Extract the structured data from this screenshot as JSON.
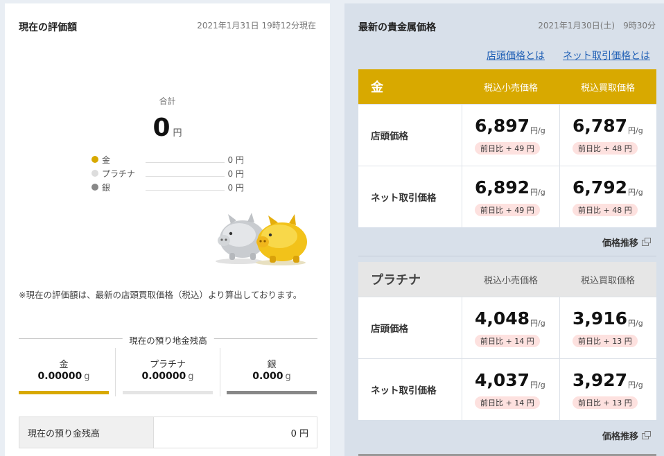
{
  "left": {
    "title": "現在の評価額",
    "timestamp": "2021年1月31日 19時12分現在",
    "total_label": "合計",
    "total_value": "0",
    "total_unit": "円",
    "breakdown": [
      {
        "name": "金",
        "value": "0 円",
        "color": "#d8a900"
      },
      {
        "name": "プラチナ",
        "value": "0 円",
        "color": "#dddddd"
      },
      {
        "name": "銀",
        "value": "0 円",
        "color": "#888888"
      }
    ],
    "note": "※現在の評価額は、最新の店頭買取価格（税込）より算出しております。",
    "holdings_title": "現在の預り地金残高",
    "holdings": [
      {
        "name": "金",
        "amount": "0.00000",
        "unit": "g",
        "color": "#d8a900"
      },
      {
        "name": "プラチナ",
        "amount": "0.00000",
        "unit": "g",
        "color": "#e5e5e5"
      },
      {
        "name": "銀",
        "amount": "0.000",
        "unit": "g",
        "color": "#888888"
      }
    ],
    "cash_label": "現在の預り金残高",
    "cash_value": "0 円"
  },
  "right": {
    "title": "最新の貴金属価格",
    "timestamp": "2021年1月30日(土)　9時30分",
    "link_store": "店頭価格とは",
    "link_net": "ネット取引価格とは",
    "trend_label": "価格推移",
    "tables": [
      {
        "metal": "金",
        "col_retail": "税込小売価格",
        "col_buy": "税込買取価格",
        "rows": [
          {
            "label": "店頭価格",
            "retail": "6,897",
            "retail_unit": "円/g",
            "retail_change": "前日比 + 49 円",
            "buy": "6,787",
            "buy_unit": "円/g",
            "buy_change": "前日比 + 48 円"
          },
          {
            "label": "ネット取引価格",
            "retail": "6,892",
            "retail_unit": "円/g",
            "retail_change": "前日比 + 49 円",
            "buy": "6,792",
            "buy_unit": "円/g",
            "buy_change": "前日比 + 48 円"
          }
        ]
      },
      {
        "metal": "プラチナ",
        "col_retail": "税込小売価格",
        "col_buy": "税込買取価格",
        "rows": [
          {
            "label": "店頭価格",
            "retail": "4,048",
            "retail_unit": "円/g",
            "retail_change": "前日比 + 14 円",
            "buy": "3,916",
            "buy_unit": "円/g",
            "buy_change": "前日比 + 13 円"
          },
          {
            "label": "ネット取引価格",
            "retail": "4,037",
            "retail_unit": "円/g",
            "retail_change": "前日比 + 14 円",
            "buy": "3,927",
            "buy_unit": "円/g",
            "buy_change": "前日比 + 13 円"
          }
        ]
      }
    ]
  }
}
